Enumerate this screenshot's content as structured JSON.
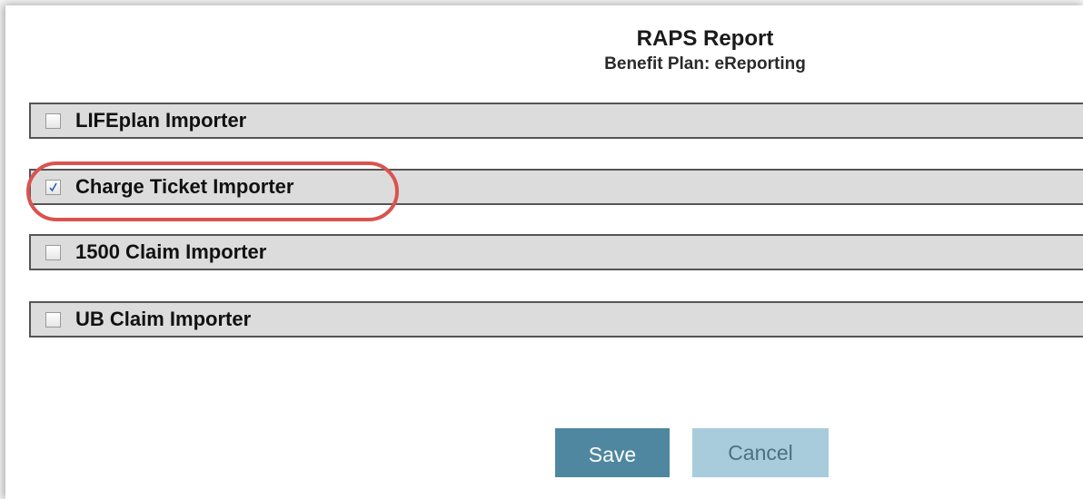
{
  "report": {
    "title": "RAPS Report",
    "subtitle": "Benefit Plan: eReporting"
  },
  "importers": [
    {
      "label": "LIFEplan Importer",
      "checked": false
    },
    {
      "label": "Charge Ticket Importer",
      "checked": true
    },
    {
      "label": "1500 Claim Importer",
      "checked": false
    },
    {
      "label": "UB Claim Importer",
      "checked": false
    }
  ],
  "highlight_color": "#d9534f",
  "buttons": {
    "save_label": "Save",
    "cancel_label": "Cancel"
  },
  "colors": {
    "save_bg": "#4f87a0",
    "cancel_bg": "#a8ccdb",
    "row_bg": "#dcdcdc"
  }
}
